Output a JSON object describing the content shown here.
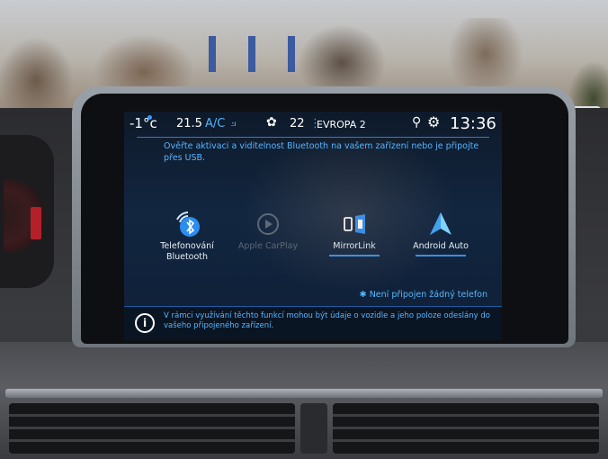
{
  "status_bar": {
    "exterior_temp": "-1°c",
    "cabin_temp": "21.5",
    "ac_label": "A/C",
    "fan_level": "22",
    "radio_station": "EVROPA 2",
    "clock": "13:36"
  },
  "prompt": "Ověřte aktivaci a viditelnost Bluetooth na vašem zařízení nebo je připojte přes USB.",
  "tiles": [
    {
      "label": "Telefonování Bluetooth",
      "enabled": true
    },
    {
      "label": "Apple CarPlay",
      "enabled": false
    },
    {
      "label": "MirrorLink",
      "enabled": true
    },
    {
      "label": "Android Auto",
      "enabled": true
    }
  ],
  "bluetooth_status": "Není připojen žádný telefon",
  "info_text": "V rámci využívání těchto funkcí mohou být údaje o vozidle a jeho poloze odeslány do vašeho připojeného zařízení.",
  "colors": {
    "accent": "#56b6ff",
    "screen_bg": "#122640",
    "disabled": "#5c6775"
  },
  "icons": {
    "bluetooth": "bluetooth-icon",
    "carplay": "play-circle-icon",
    "mirrorlink": "mirrorlink-icon",
    "android_auto": "android-auto-icon",
    "info": "info-icon",
    "settings": "gear-icon",
    "location": "pin-icon",
    "seat": "seat-icon",
    "fan": "fan-icon"
  }
}
